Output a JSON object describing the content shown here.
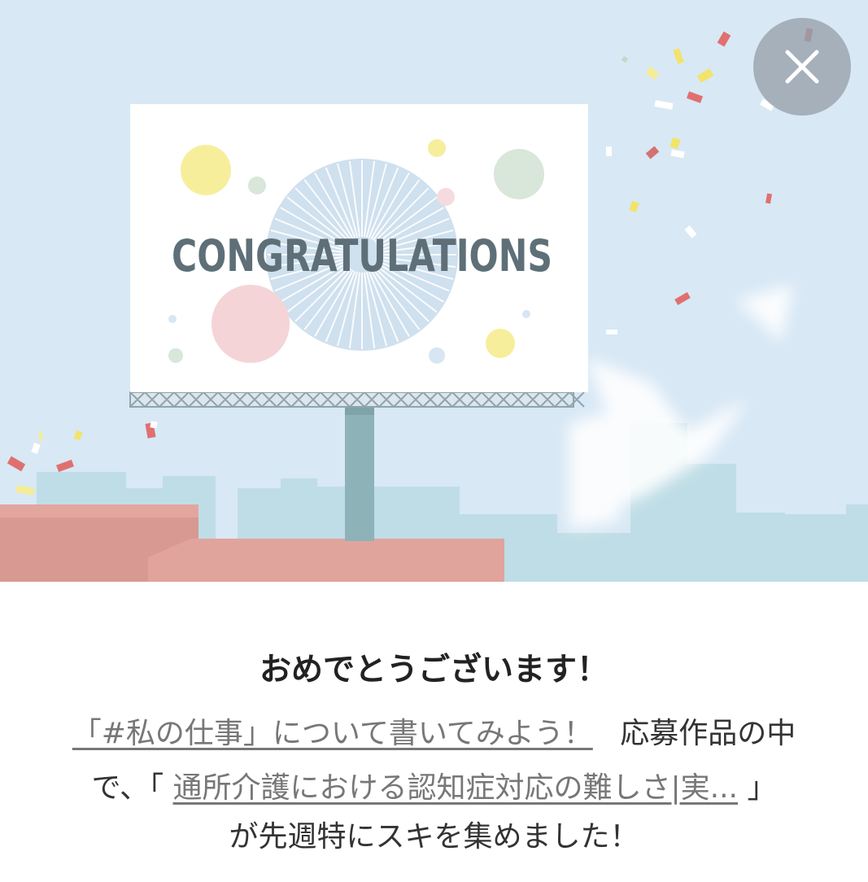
{
  "hero": {
    "billboard_text": "CONGRATULATIONS"
  },
  "close_button": {
    "icon": "close-icon"
  },
  "message": {
    "title": "おめでとうございます！",
    "contest_link": "「#私の仕事」について書いてみよう！",
    "text_after_contest": "応募作品の中",
    "text_de": "で、「",
    "article_link": "通所介護における認知症対応の難しさ|実...",
    "text_close_bracket": "」",
    "text_end": "が先週特にスキを集めました！"
  }
}
